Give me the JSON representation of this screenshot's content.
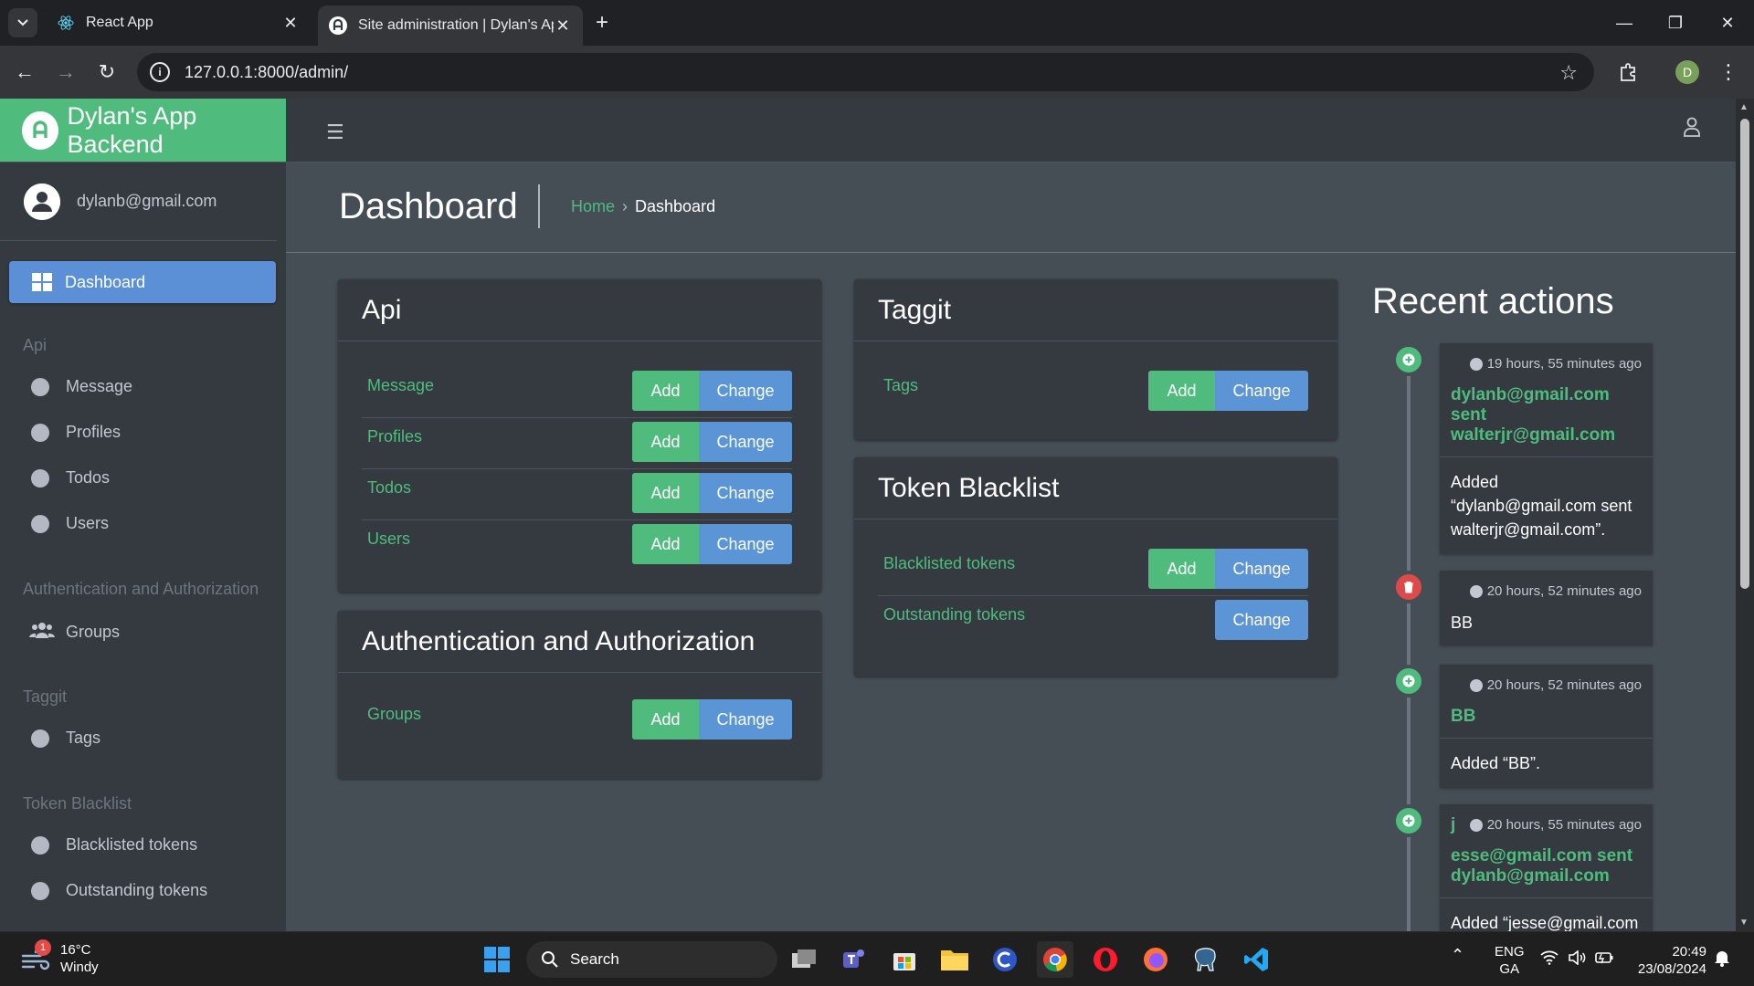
{
  "browser": {
    "tabs": [
      {
        "title": "React App",
        "active": false
      },
      {
        "title": "Site administration | Dylan's App",
        "active": true
      }
    ],
    "url": "127.0.0.1:8000/admin/",
    "profile_initial": "D"
  },
  "sidebar": {
    "brand": "Dylan's App Backend",
    "user": "dylanb@gmail.com",
    "active_item": "Dashboard",
    "sections": [
      {
        "header": "Api",
        "items": [
          "Message",
          "Profiles",
          "Todos",
          "Users"
        ]
      },
      {
        "header": "Authentication and Authorization",
        "items": [
          "Groups"
        ]
      },
      {
        "header": "Taggit",
        "items": [
          "Tags"
        ]
      },
      {
        "header": "Token Blacklist",
        "items": [
          "Blacklisted tokens",
          "Outstanding tokens"
        ]
      }
    ]
  },
  "content": {
    "title": "Dashboard",
    "breadcrumb": {
      "home": "Home",
      "sep": "›",
      "current": "Dashboard"
    },
    "add_label": "Add",
    "change_label": "Change",
    "cards": {
      "api": {
        "title": "Api",
        "rows": [
          "Message",
          "Profiles",
          "Todos",
          "Users"
        ]
      },
      "auth": {
        "title": "Authentication and Authorization",
        "rows": [
          "Groups"
        ]
      },
      "taggit": {
        "title": "Taggit",
        "rows": [
          "Tags"
        ]
      },
      "token": {
        "title": "Token Blacklist",
        "rows": [
          "Blacklisted tokens",
          "Outstanding tokens"
        ]
      }
    }
  },
  "recent_actions": {
    "title": "Recent actions",
    "items": [
      {
        "time": "19 hours, 55 minutes ago",
        "type": "add",
        "head": "dylanb@gmail.com sent walterjr@gmail.com",
        "body": "Added “dylanb@gmail.com sent walterjr@gmail.com”."
      },
      {
        "time": "20 hours, 52 minutes ago",
        "type": "delete",
        "head": "",
        "body": "BB"
      },
      {
        "time": "20 hours, 52 minutes ago",
        "type": "add",
        "head": "BB",
        "body": "Added “BB”."
      },
      {
        "time": "20 hours, 55 minutes ago",
        "type": "add",
        "head_prefix": "j",
        "head": "esse@gmail.com sent dylanb@gmail.com",
        "body": "Added “jesse@gmail.com"
      }
    ]
  },
  "taskbar": {
    "weather": {
      "temp": "16°C",
      "cond": "Windy",
      "badge": "1"
    },
    "search": "Search",
    "lang": {
      "line1": "ENG",
      "line2": "GA"
    },
    "clock": {
      "time": "20:49",
      "date": "23/08/2024"
    }
  },
  "colors": {
    "accent_green": "#4fbc7e",
    "accent_blue": "#5b95d6",
    "danger": "#dc4a4a"
  }
}
